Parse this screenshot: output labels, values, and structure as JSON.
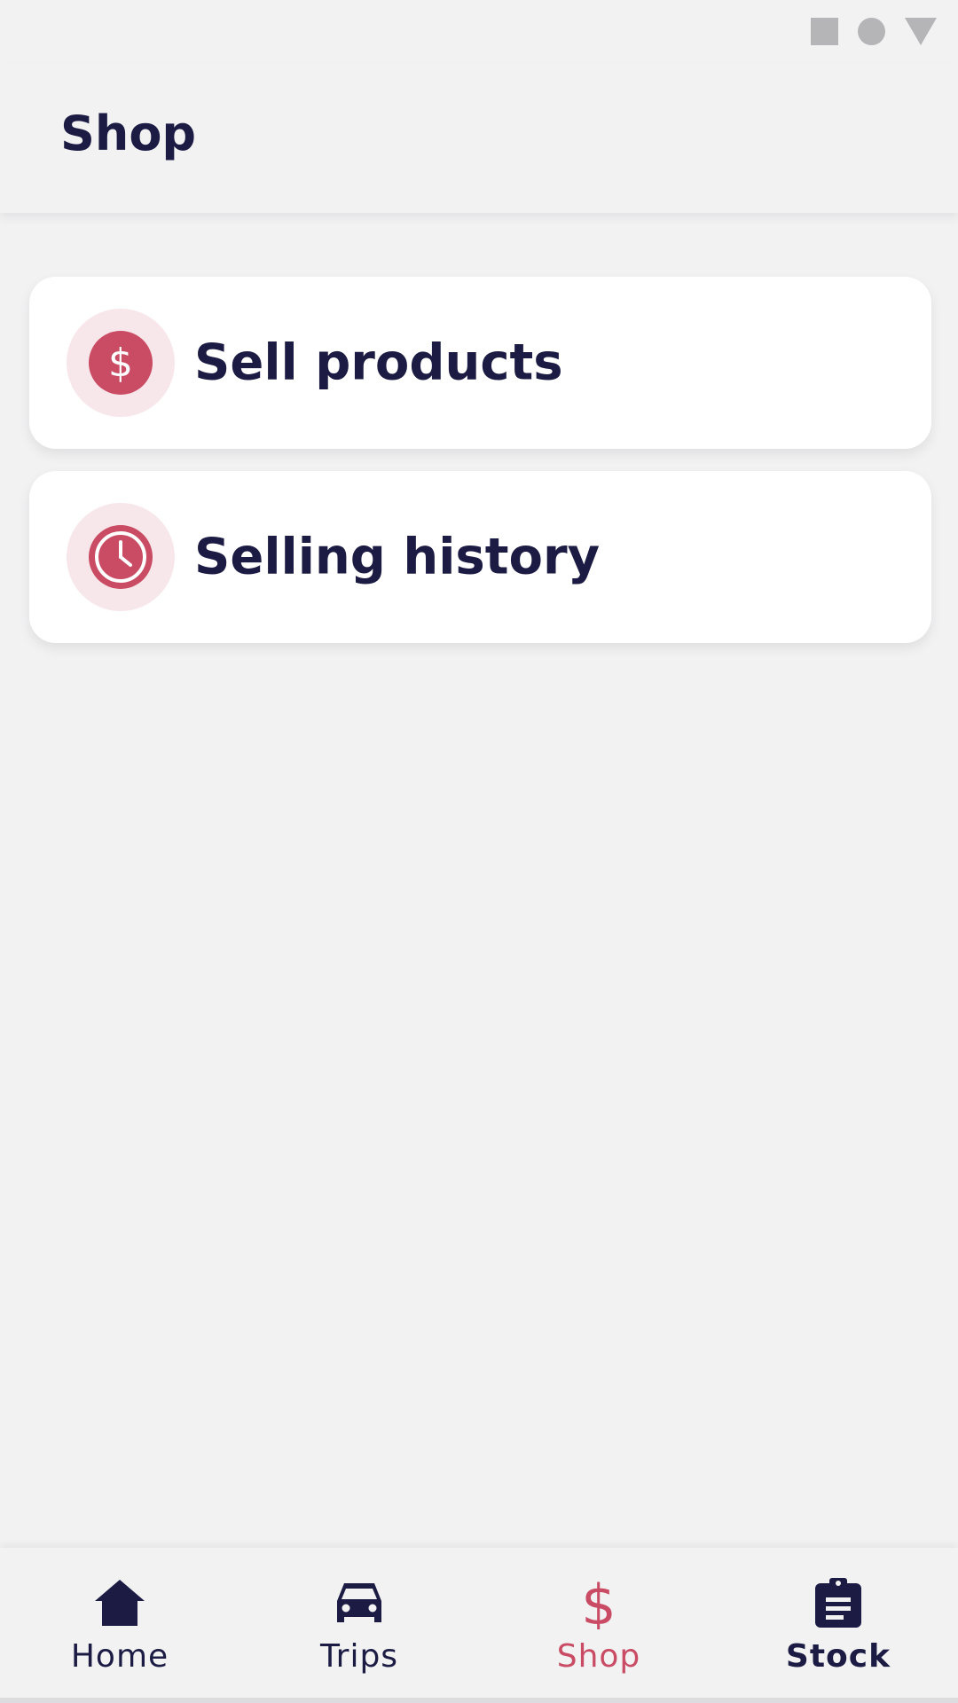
{
  "app_bar": {
    "title": "Shop"
  },
  "menu": {
    "items": [
      {
        "label": "Sell products",
        "icon": "dollar-icon"
      },
      {
        "label": "Selling history",
        "icon": "clock-icon"
      }
    ]
  },
  "bottom_nav": {
    "items": [
      {
        "label": "Home",
        "icon": "home-icon",
        "active": false
      },
      {
        "label": "Trips",
        "icon": "car-icon",
        "active": false
      },
      {
        "label": "Shop",
        "icon": "dollar-icon",
        "active": true
      },
      {
        "label": "Stock",
        "icon": "clipboard-icon",
        "active": false
      }
    ]
  },
  "colors": {
    "primary_text": "#1b1b44",
    "accent": "#c94c64",
    "accent_soft": "#f8e7ea",
    "background": "#f2f2f3",
    "card": "#ffffff"
  }
}
